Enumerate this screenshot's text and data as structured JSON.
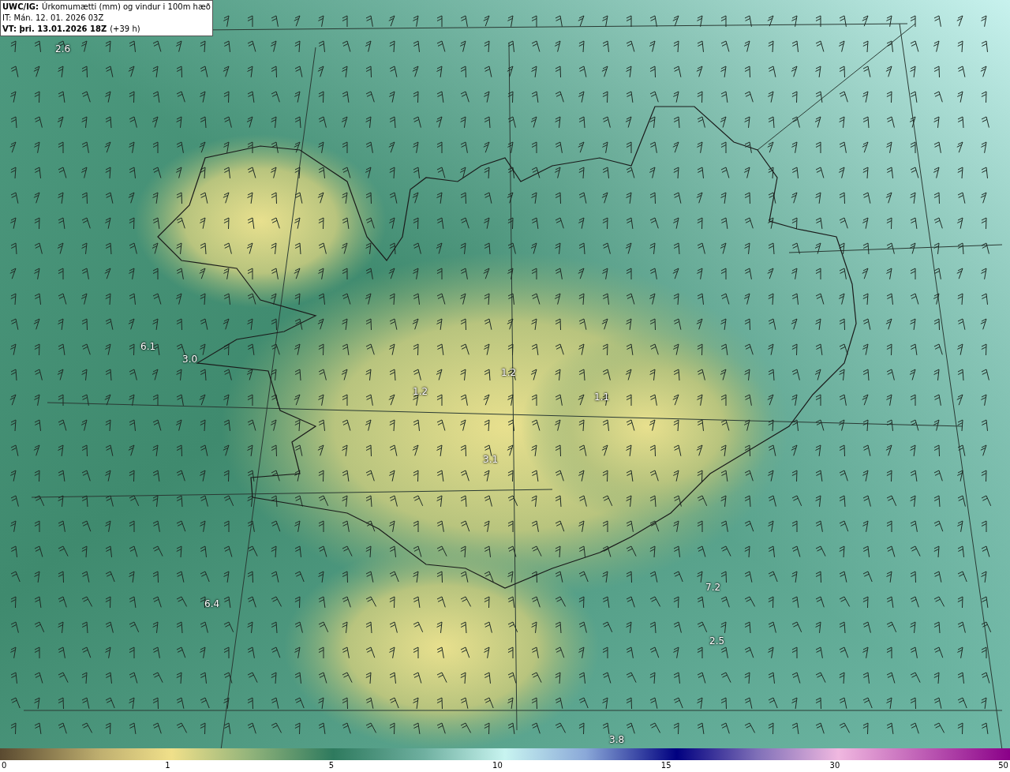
{
  "header": {
    "model": "UWC/IG:",
    "title": "Úrkomumætti (mm) og vindur i 100m hæð",
    "init": "IT: Mán. 12. 01. 2026 03Z",
    "valid": "VT: þri. 13.01.2026 18Z",
    "offset": "(+39 h)"
  },
  "map_labels": [
    "2.6",
    "6.1",
    "3.0",
    "1.2",
    "1.2",
    "1.1",
    "3.1",
    "6.4",
    "7.2",
    "2.5",
    "3.8"
  ],
  "scale_ticks": [
    "0",
    "1",
    "5",
    "10",
    "15",
    "30",
    "50"
  ]
}
